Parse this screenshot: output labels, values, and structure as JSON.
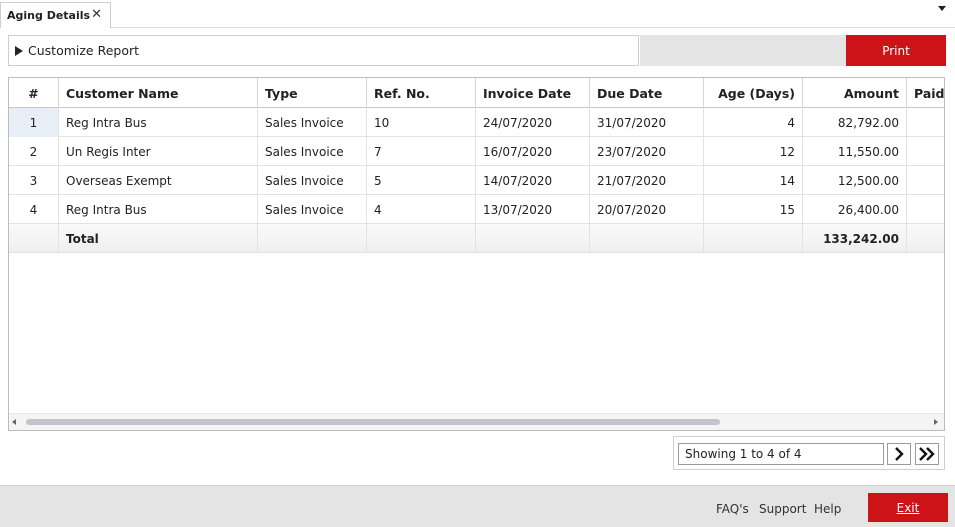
{
  "tab": {
    "title": "Aging Details",
    "close_glyph": "✕"
  },
  "customize": {
    "label": "Customize Report"
  },
  "toolbar": {
    "print_label": "Print"
  },
  "colors": {
    "accent": "#cc1317",
    "footer_bg": "#e4e4e4",
    "selected_cell": "#e7eef6"
  },
  "grid": {
    "columns": [
      "#",
      "Customer Name",
      "Type",
      "Ref. No.",
      "Invoice Date",
      "Due Date",
      "Age (Days)",
      "Amount",
      "Paid"
    ],
    "rows": [
      [
        "1",
        "Reg Intra Bus",
        "Sales Invoice",
        "10",
        "24/07/2020",
        "31/07/2020",
        "4",
        "82,792.00",
        ""
      ],
      [
        "2",
        "Un Regis Inter",
        "Sales Invoice",
        "7",
        "16/07/2020",
        "23/07/2020",
        "12",
        "11,550.00",
        ""
      ],
      [
        "3",
        "Overseas Exempt",
        "Sales Invoice",
        "5",
        "14/07/2020",
        "21/07/2020",
        "14",
        "12,500.00",
        ""
      ],
      [
        "4",
        "Reg Intra Bus",
        "Sales Invoice",
        "4",
        "13/07/2020",
        "20/07/2020",
        "15",
        "26,400.00",
        ""
      ]
    ],
    "total": {
      "label": "Total",
      "amount": "133,242.00"
    }
  },
  "pager": {
    "status": "Showing 1 to 4 of 4"
  },
  "footer": {
    "faq": "FAQ's",
    "support": "Support",
    "help": "Help",
    "exit": "Exit"
  }
}
